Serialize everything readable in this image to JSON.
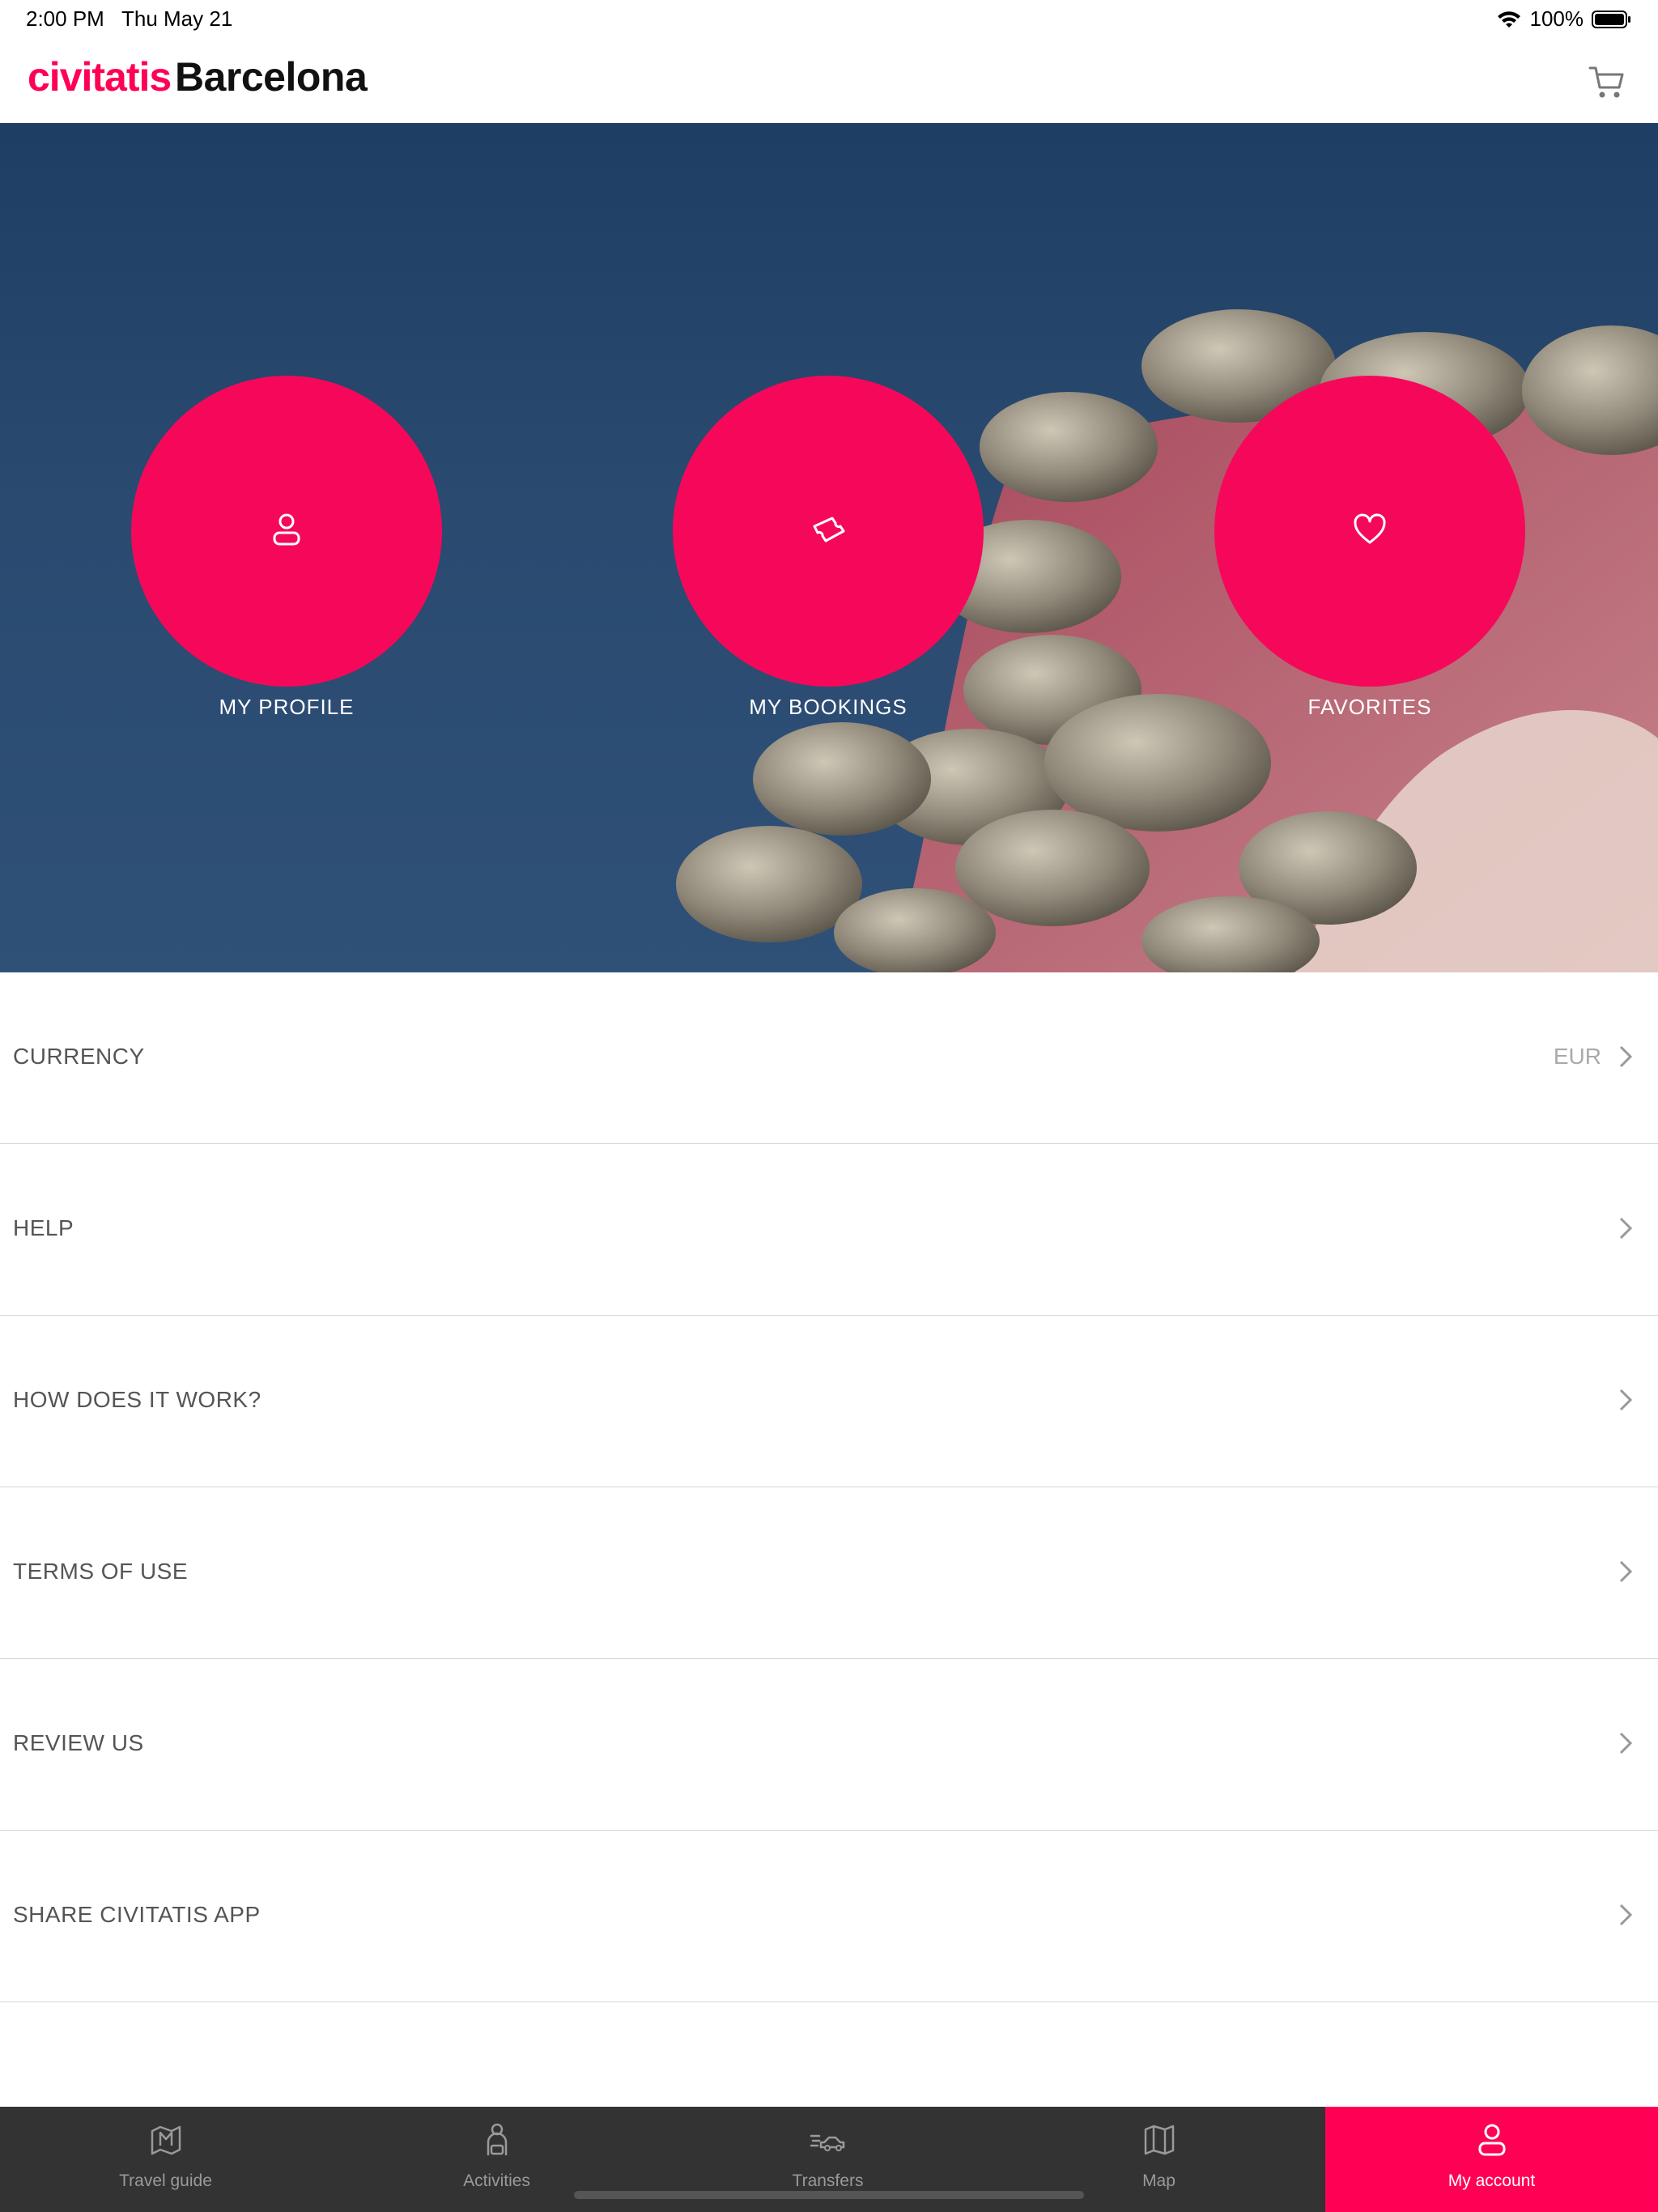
{
  "status_bar": {
    "time": "2:00 PM",
    "date": "Thu May 21",
    "battery": "100%"
  },
  "header": {
    "brand": "civitatis",
    "city": "Barcelona",
    "cart_icon": "cart-icon"
  },
  "hero": {
    "actions": [
      {
        "label": "MY PROFILE",
        "icon": "user-icon"
      },
      {
        "label": "MY BOOKINGS",
        "icon": "ticket-icon"
      },
      {
        "label": "FAVORITES",
        "icon": "heart-icon"
      }
    ],
    "accent": "#f5085a"
  },
  "menu": [
    {
      "label": "CURRENCY",
      "value": "EUR"
    },
    {
      "label": "HELP"
    },
    {
      "label": "HOW DOES IT WORK?"
    },
    {
      "label": "TERMS OF USE"
    },
    {
      "label": "REVIEW US"
    },
    {
      "label": "SHARE CIVITATIS APP"
    }
  ],
  "tabbar": {
    "tabs": [
      {
        "label": "Travel guide",
        "icon": "map-guide-icon"
      },
      {
        "label": "Activities",
        "icon": "person-activity-icon"
      },
      {
        "label": "Transfers",
        "icon": "car-transfer-icon"
      },
      {
        "label": "Map",
        "icon": "map-icon"
      },
      {
        "label": "My account",
        "icon": "user-icon",
        "active": true
      }
    ],
    "active_color": "#ff0055"
  }
}
